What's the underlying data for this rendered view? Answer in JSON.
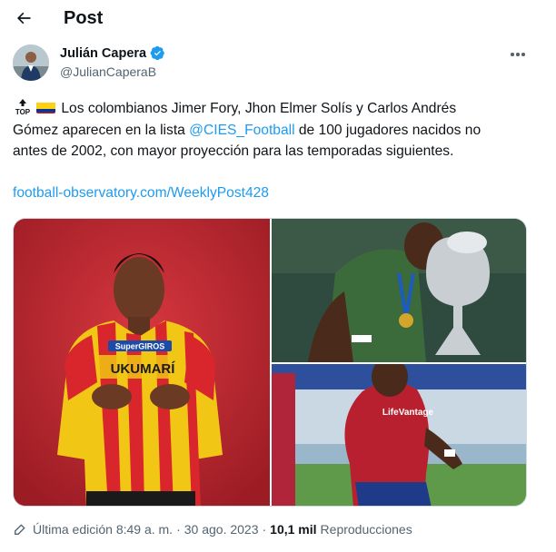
{
  "header": {
    "title": "Post"
  },
  "author": {
    "name": "Julián Capera",
    "handle": "@JulianCaperaB"
  },
  "tweet": {
    "emoji": "TOP",
    "line1": "Los colombianos Jimer Fory, Jhon Elmer Solís y Carlos Andrés",
    "line2_a": "Gómez aparecen en la lista ",
    "mention": "@CIES_Football",
    "line2_b": " de 100 jugadores nacidos no",
    "line3": "antes de 2002, con mayor proyección para las temporadas siguientes.",
    "link": "football-observatory.com/WeeklyPost428"
  },
  "photos": {
    "p1": {
      "jersey_sponsor": "UKUMARÍ",
      "chest_brand": "SuperGIROS"
    },
    "p3": {
      "jersey_sponsor": "LifeVantage"
    }
  },
  "meta": {
    "edited": "Última edición 8:49 a. m.",
    "dot": "·",
    "date": "30 ago. 2023",
    "views": "10,1 mil",
    "views_label": "Reproducciones"
  },
  "colors": {
    "accent": "#1d9bf0",
    "text": "#0f1419",
    "muted": "#536471",
    "verified": "#1d9bf0"
  },
  "icons": {
    "back": "arrow-left-icon",
    "verified": "verified-badge-icon",
    "more": "more-horizontal-icon",
    "edit": "pencil-icon",
    "emoji": "top-arrow-emoji",
    "flag": "colombia-flag-emoji"
  }
}
